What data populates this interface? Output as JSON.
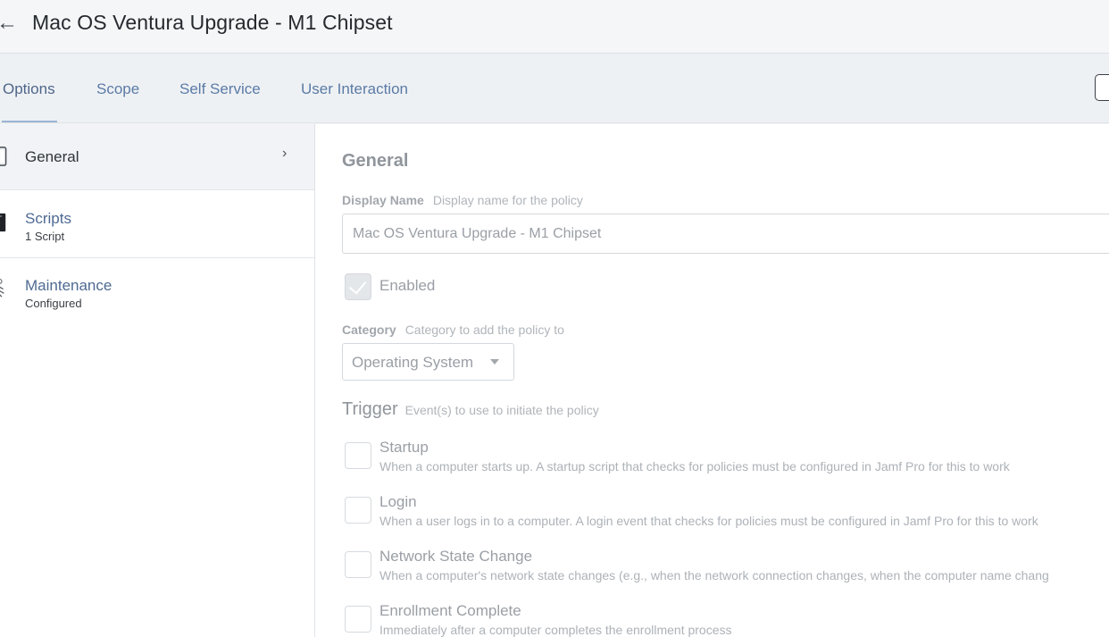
{
  "header": {
    "back_icon": "arrow-left-icon",
    "back_glyph": "←",
    "title": "Mac OS Ventura Upgrade - M1 Chipset"
  },
  "tabs": [
    {
      "label": "Options",
      "active": true
    },
    {
      "label": "Scope",
      "active": false
    },
    {
      "label": "Self Service",
      "active": false
    },
    {
      "label": "User Interaction",
      "active": false
    }
  ],
  "sidebar": {
    "items": [
      {
        "title": "General",
        "subtitle": "",
        "icon": "general-icon",
        "active": true,
        "chevron": "›"
      },
      {
        "title": "Scripts",
        "subtitle": "1 Script",
        "icon": "script-icon",
        "active": false
      },
      {
        "title": "Maintenance",
        "subtitle": "Configured",
        "icon": "maintenance-icon",
        "active": false
      }
    ]
  },
  "main": {
    "section_title": "General",
    "display_name": {
      "label": "Display Name",
      "hint": "Display name for the policy",
      "value": "Mac OS Ventura Upgrade - M1 Chipset"
    },
    "enabled": {
      "label": "Enabled",
      "checked": true
    },
    "category": {
      "label": "Category",
      "hint": "Category to add the policy to",
      "value": "Operating System"
    },
    "trigger": {
      "title": "Trigger",
      "hint": "Event(s) to use to initiate the policy",
      "options": [
        {
          "label": "Startup",
          "desc": "When a computer starts up. A startup script that checks for policies must be configured in Jamf Pro for this to work",
          "checked": false
        },
        {
          "label": "Login",
          "desc": "When a user logs in to a computer. A login event that checks for policies must be configured in Jamf Pro for this to work",
          "checked": false
        },
        {
          "label": "Network State Change",
          "desc": "When a computer's network state changes (e.g., when the network connection changes, when the computer name chang",
          "checked": false
        },
        {
          "label": "Enrollment Complete",
          "desc": "Immediately after a computer completes the enrollment process",
          "checked": false
        }
      ]
    }
  },
  "colors": {
    "tab_link": "#5b7ba6",
    "sidebar_title": "#4e6a92",
    "muted_text": "#9a9fa5"
  }
}
